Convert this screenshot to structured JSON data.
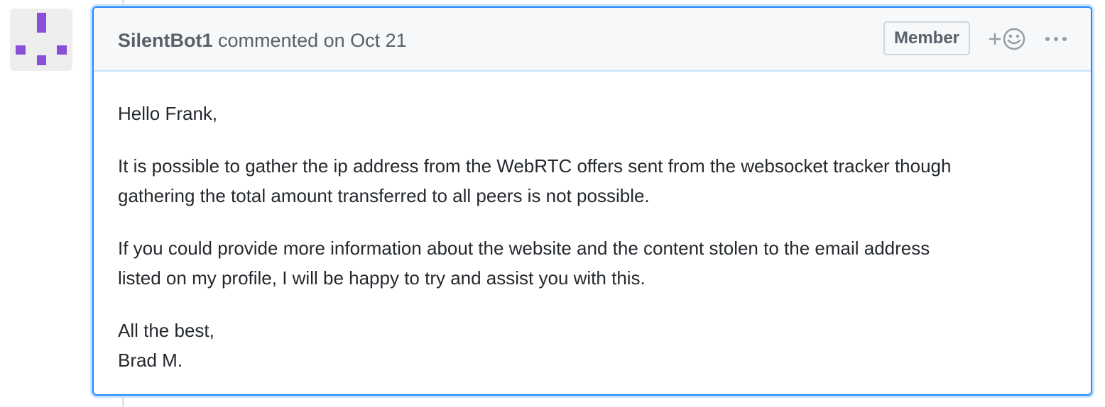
{
  "comment": {
    "author": "SilentBot1",
    "action_text": "commented on Oct 21",
    "role_badge": "Member",
    "body": {
      "greeting": "Hello Frank,",
      "paragraph_1_line_1": "It is possible to gather the ip address from the WebRTC offers sent from the websocket tracker though",
      "paragraph_1_line_2": "gathering the total amount transferred to all peers is not possible.",
      "paragraph_2_line_1": "If you could provide more information about the website and the content stolen to the email address",
      "paragraph_2_line_2": "listed on my profile, I will be happy to try and assist you with this.",
      "closing": "All the best,",
      "signature": "Brad M."
    }
  },
  "icons": {
    "avatar": "identicon-avatar",
    "reaction": "add-reaction-smiley-icon",
    "more": "kebab-horizontal-icon"
  },
  "colors": {
    "avatar_purple": "#8a4fd8",
    "focus_border": "#2188ff",
    "header_background": "#f6f8fa"
  }
}
